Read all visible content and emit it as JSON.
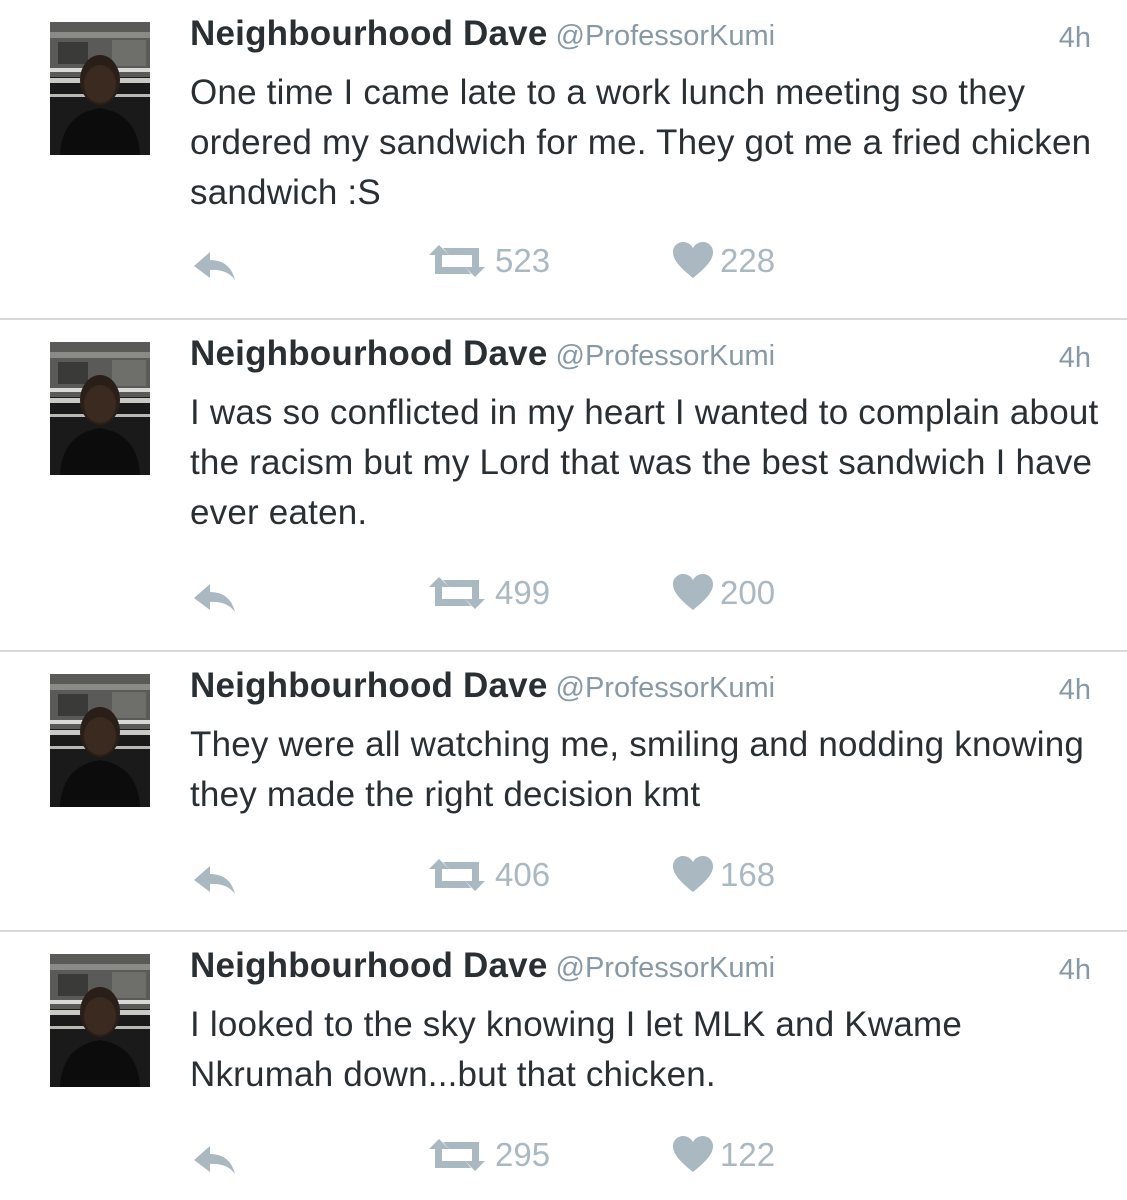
{
  "colors": {
    "name": "#292f33",
    "secondary": "#8899a6",
    "action_icon": "#aab8c2",
    "divider": "#d6d9dc"
  },
  "icons": {
    "reply": "reply-arrow-icon",
    "retweet": "retweet-icon",
    "like": "heart-icon"
  },
  "tweets": [
    {
      "name": "Neighbourhood Dave",
      "handle": "@ProfessorKumi",
      "time": "4h",
      "text": "One time I came late to a work lunch meeting so they ordered my sandwich for me. They got me a fried chicken sandwich :S",
      "retweets": "523",
      "likes": "228"
    },
    {
      "name": "Neighbourhood Dave",
      "handle": "@ProfessorKumi",
      "time": "4h",
      "text": "I was so conflicted in my heart I wanted to complain about the racism but my Lord that was the best sandwich I have ever eaten.",
      "retweets": "499",
      "likes": "200"
    },
    {
      "name": "Neighbourhood Dave",
      "handle": "@ProfessorKumi",
      "time": "4h",
      "text": "They were all watching me, smiling and nodding knowing they made the right decision kmt",
      "retweets": "406",
      "likes": "168"
    },
    {
      "name": "Neighbourhood Dave",
      "handle": "@ProfessorKumi",
      "time": "4h",
      "text": "I looked to the sky knowing I let MLK and Kwame Nkrumah down...but that chicken.",
      "retweets": "295",
      "likes": "122"
    }
  ]
}
